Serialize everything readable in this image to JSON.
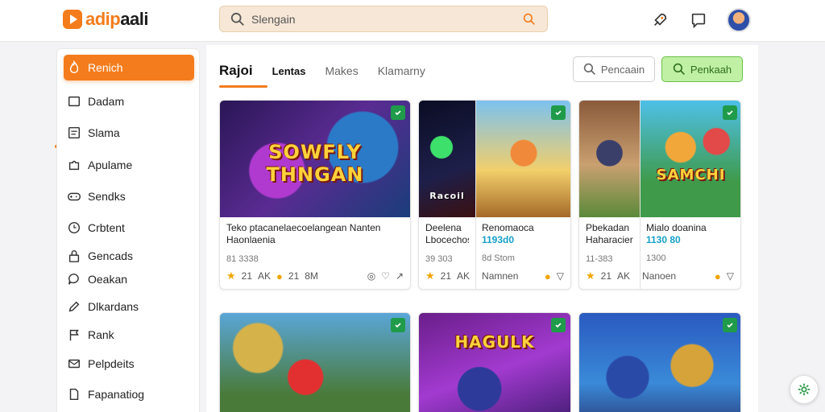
{
  "app": {
    "logo_text_orange": "adip",
    "logo_text_dark": "aali"
  },
  "search": {
    "value": "Slengain"
  },
  "sidebar": {
    "items": [
      {
        "label": "Renich",
        "icon": "flame-icon",
        "active": true
      },
      {
        "label": "Dadam",
        "icon": "square-icon"
      },
      {
        "label": "Slama",
        "icon": "grid-box-icon"
      },
      {
        "label": "Apulame",
        "icon": "puzzle-icon"
      },
      {
        "label": "Sendks",
        "icon": "controller-icon"
      },
      {
        "label": "Crbtent",
        "icon": "clock-icon"
      },
      {
        "label": "Gencads",
        "icon": "lock-icon"
      },
      {
        "label": "Oeakan",
        "icon": "chat-icon"
      },
      {
        "label": "Dlkardans",
        "icon": "pen-icon"
      },
      {
        "label": "Rank",
        "icon": "flag-icon"
      },
      {
        "label": "Pelpdeits",
        "icon": "mail-icon"
      },
      {
        "label": "Fapanatiog",
        "icon": "document-icon"
      }
    ]
  },
  "tabs": [
    {
      "label": "Rajoi"
    },
    {
      "label": "Lentas"
    },
    {
      "label": "Makes"
    },
    {
      "label": "Klamarny"
    }
  ],
  "actions": {
    "secondary_label": "Pencaain",
    "primary_label": "Penkaah"
  },
  "cards_row1": [
    {
      "art_title": "SOWFLY THNGAN",
      "title": "Teko ptacanelaecoelangean Nanten",
      "subtitle": "Haonlaenia",
      "stats": "81 3338",
      "meta": [
        "21",
        "AK",
        "21",
        "8M"
      ]
    },
    {
      "art_title": "Racoil",
      "title": "Deelena",
      "subtitle": "Lbocechosk",
      "stats": "39 303",
      "meta": [
        "21",
        "AK"
      ]
    },
    {
      "title": "Renomaoca",
      "price": "1193d0",
      "stats": "8d Stom",
      "meta": [
        "Namnen"
      ]
    },
    {
      "title": "Pbekadan",
      "subtitle": "Haharacier",
      "stats": "11-383",
      "meta": [
        "21",
        "AK"
      ]
    },
    {
      "art_title": "SAMCHI",
      "title": "Mialo doanina",
      "price": "1130 80",
      "stats": "1300",
      "meta": [
        "Nanoen"
      ]
    }
  ],
  "cards_row2": [
    {
      "art_title": ""
    },
    {
      "art_title": "HAGULK"
    },
    {
      "art_title": ""
    }
  ]
}
